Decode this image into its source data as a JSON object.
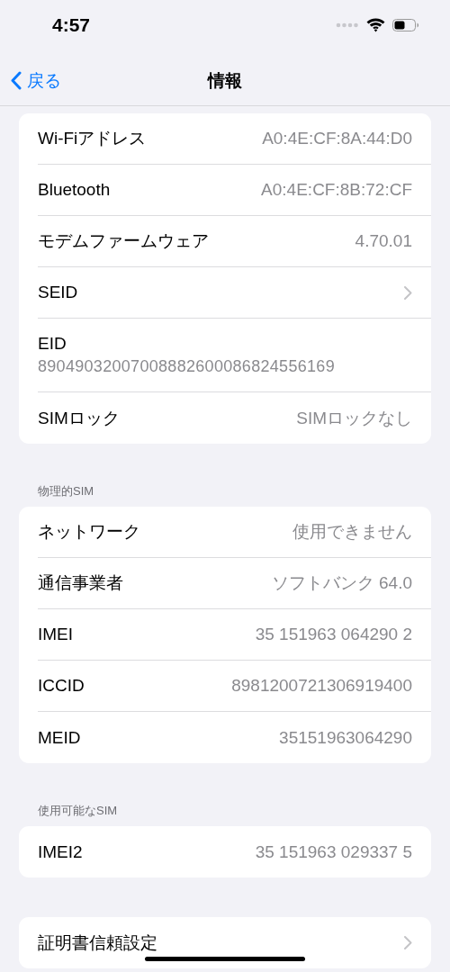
{
  "status_bar": {
    "time": "4:57"
  },
  "nav": {
    "back": "戻る",
    "title": "情報"
  },
  "sections": [
    {
      "rows": [
        {
          "kind": "value",
          "label": "Wi-Fiアドレス",
          "value": "A0:4E:CF:8A:44:D0"
        },
        {
          "kind": "value",
          "label": "Bluetooth",
          "value": "A0:4E:CF:8B:72:CF"
        },
        {
          "kind": "value",
          "label": "モデムファームウェア",
          "value": "4.70.01"
        },
        {
          "kind": "link",
          "label": "SEID"
        },
        {
          "kind": "stacked",
          "label": "EID",
          "value": "89049032007008882600086824556169"
        },
        {
          "kind": "value",
          "label": "SIMロック",
          "value": "SIMロックなし"
        }
      ]
    },
    {
      "header": "物理的SIM",
      "rows": [
        {
          "kind": "value",
          "label": "ネットワーク",
          "value": "使用できません"
        },
        {
          "kind": "value",
          "label": "通信事業者",
          "value": "ソフトバンク 64.0"
        },
        {
          "kind": "value",
          "label": "IMEI",
          "value": "35 151963 064290 2"
        },
        {
          "kind": "value",
          "label": "ICCID",
          "value": "8981200721306919400"
        },
        {
          "kind": "value",
          "label": "MEID",
          "value": "35151963064290"
        }
      ]
    },
    {
      "header": "使用可能なSIM",
      "rows": [
        {
          "kind": "value",
          "label": "IMEI2",
          "value": "35 151963 029337 5"
        }
      ]
    },
    {
      "rows": [
        {
          "kind": "link",
          "label": "証明書信頼設定"
        }
      ]
    }
  ]
}
